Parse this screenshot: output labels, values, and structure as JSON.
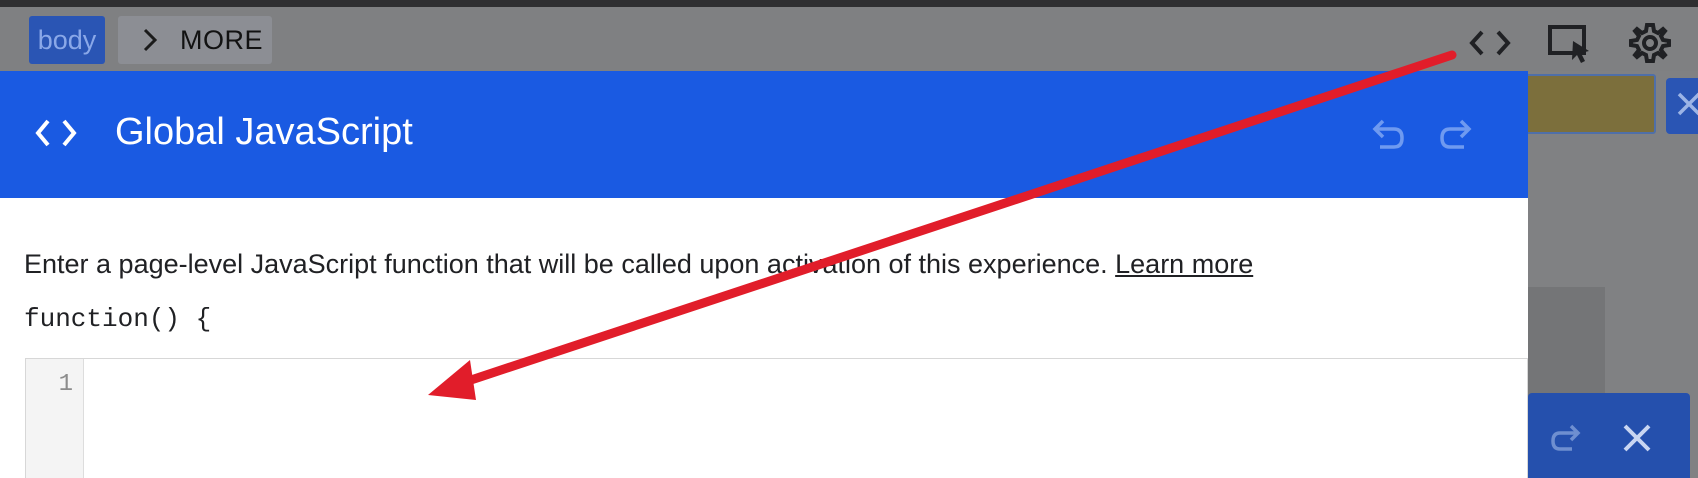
{
  "breadcrumb": {
    "items": [
      {
        "label": "body"
      },
      {
        "label": "MORE"
      }
    ]
  },
  "toolbar": {
    "icons": [
      "code-icon",
      "select-element-icon",
      "gear-icon"
    ]
  },
  "modal": {
    "title": "Global JavaScript",
    "description": "Enter a page-level JavaScript function that will be called upon activation of this experience. ",
    "learn_more": "Learn more",
    "function_open": "function() {",
    "editor": {
      "line_numbers": [
        "1"
      ],
      "content": ""
    }
  },
  "colors": {
    "header_blue": "#1a5ae2",
    "annotation_red": "#e11d2a",
    "chip_blue": "#2a55b4"
  }
}
